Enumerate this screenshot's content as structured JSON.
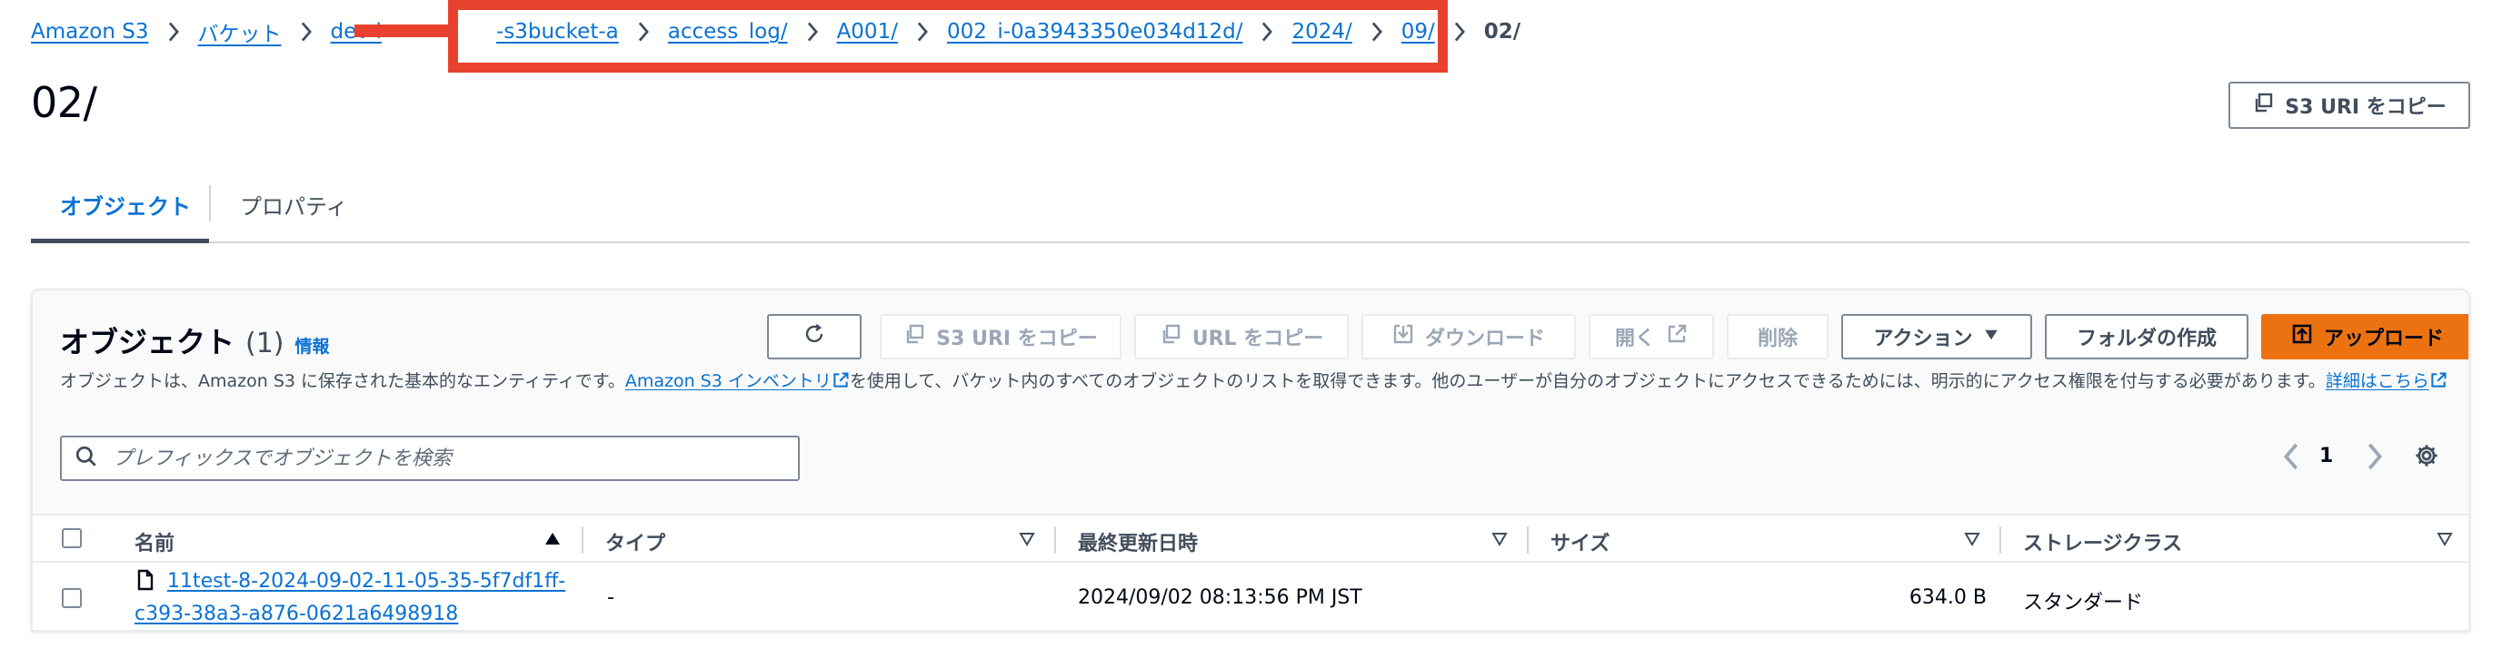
{
  "breadcrumb": {
    "items": [
      "Amazon S3",
      "バケット",
      "dev-l",
      "-s3bucket-a",
      "access_log/",
      "A001/",
      "002_i-0a3943350e034d12d/",
      "2024/",
      "09/"
    ],
    "current": "02/"
  },
  "page": {
    "title": "02/",
    "copy_uri_label": "S3 URI をコピー"
  },
  "tabs": [
    {
      "label": "オブジェクト",
      "active": true
    },
    {
      "label": "プロパティ",
      "active": false
    }
  ],
  "objects_panel": {
    "title": "オブジェクト",
    "count": "(1)",
    "info_label": "情報",
    "description_before": "オブジェクトは、Amazon S3 に保存された基本的なエンティティです。",
    "inventory_link": "Amazon S3 インベントリ",
    "description_after": "を使用して、バケット内のすべてのオブジェクトのリストを取得できます。他のユーザーが自分のオブジェクトにアクセスできるためには、明示的にアクセス権限を付与する必要があります。",
    "details_link": "詳細はこちら",
    "toolbar": {
      "copy_s3_uri": "S3 URI をコピー",
      "copy_url": "URL をコピー",
      "download": "ダウンロード",
      "open": "開く",
      "delete": "削除",
      "actions": "アクション",
      "create_folder": "フォルダの作成",
      "upload": "アップロード"
    },
    "search_placeholder": "プレフィックスでオブジェクトを検索",
    "page_number": "1"
  },
  "table": {
    "columns": [
      "名前",
      "タイプ",
      "最終更新日時",
      "サイズ",
      "ストレージクラス"
    ],
    "rows": [
      {
        "name_line1": "11test-8-2024-09-02-11-05-35-5f7df1ff-",
        "name_line2": "c393-38a3-a876-0621a6498918",
        "type": "-",
        "modified": "2024/09/02 08:13:56 PM JST",
        "size": "634.0 B",
        "storage_class": "スタンダード"
      }
    ]
  },
  "colors": {
    "link": "#0972d3",
    "primary_button": "#ec7211",
    "annotation_red": "#e8422f"
  }
}
